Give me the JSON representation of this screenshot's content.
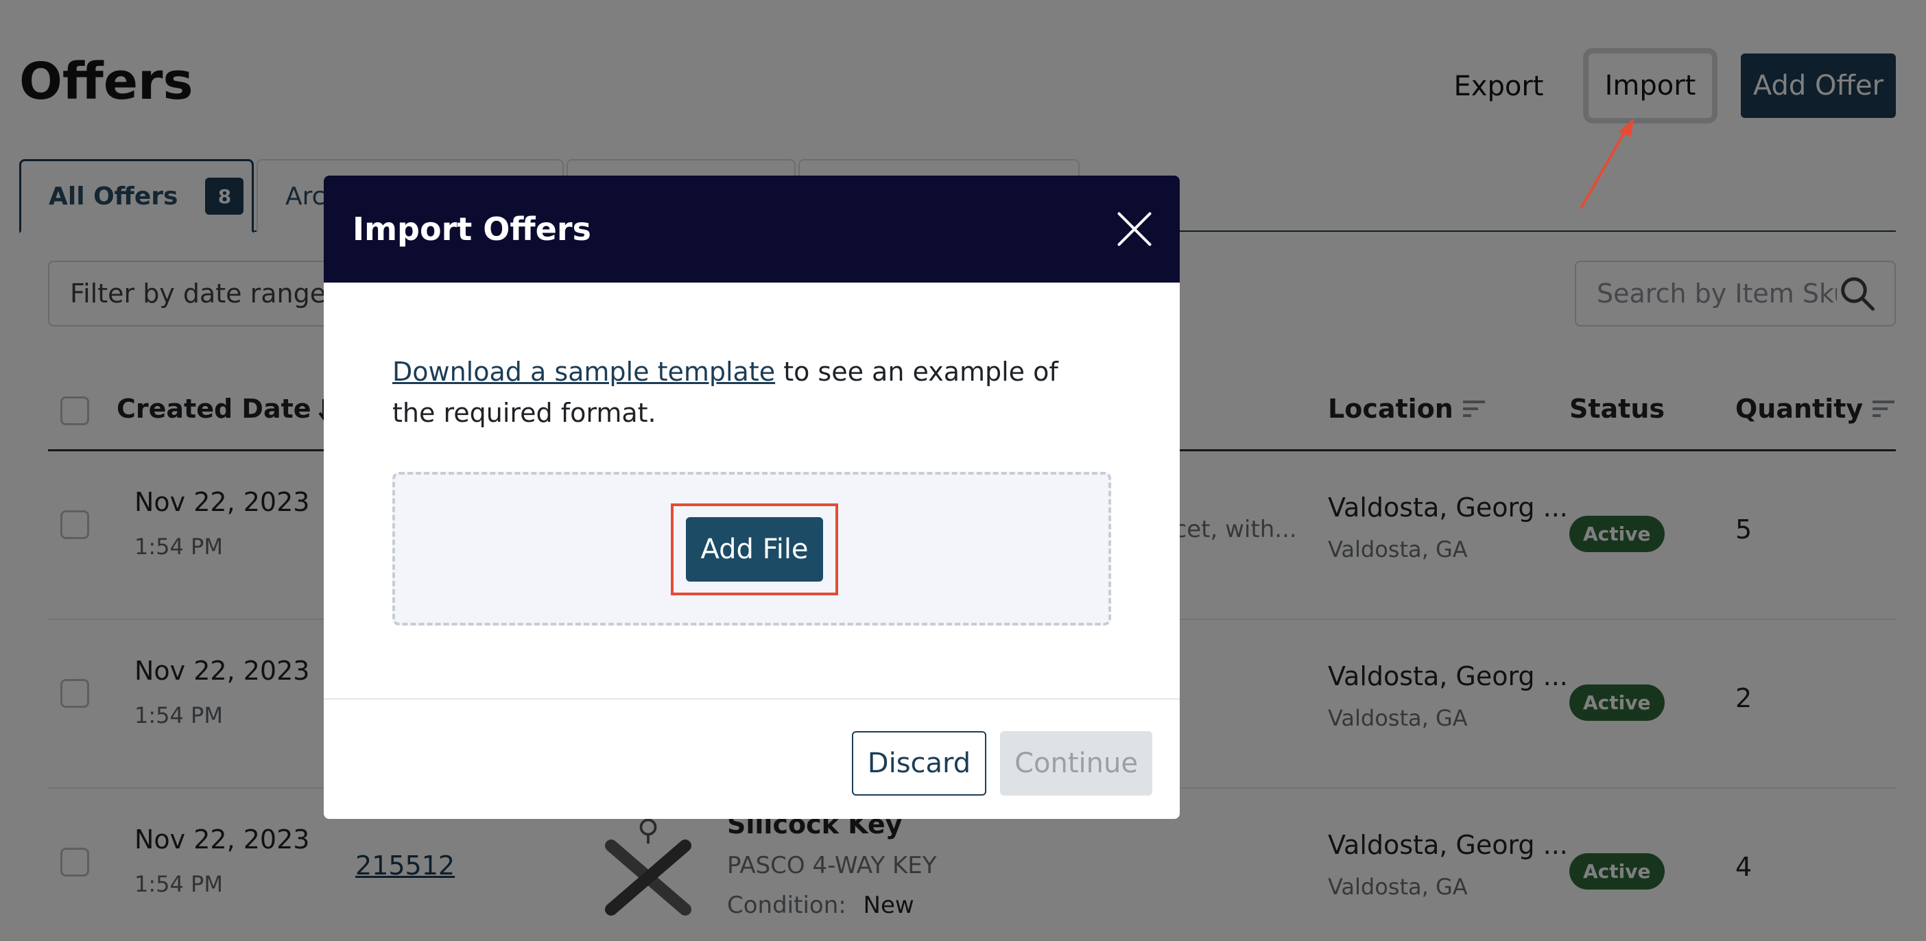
{
  "header": {
    "title": "Offers",
    "export_label": "Export",
    "import_label": "Import",
    "add_offer_label": "Add Offer"
  },
  "tabs": [
    {
      "label": "All Offers",
      "badge": "8",
      "active": true
    },
    {
      "label": "Arc",
      "active": false
    },
    {
      "label": "",
      "active": false
    },
    {
      "label": "",
      "active": false
    }
  ],
  "filters": {
    "date_range_placeholder": "Filter by date range",
    "search_placeholder": "Search by Item Sku"
  },
  "table": {
    "columns": {
      "created_date": "Created Date",
      "location": "Location",
      "status": "Status",
      "quantity": "Quantity"
    },
    "rows": [
      {
        "date": "Nov 22, 2023",
        "time": "1:54 PM",
        "description_partial": "ucet, with...",
        "location": "Valdosta, Georg ...",
        "location_sub": "Valdosta, GA",
        "status": "Active",
        "quantity": "5"
      },
      {
        "date": "Nov 22, 2023",
        "time": "1:54 PM",
        "location": "Valdosta, Georg ...",
        "location_sub": "Valdosta, GA",
        "status": "Active",
        "quantity": "2"
      },
      {
        "date": "Nov 22, 2023",
        "time": "1:54 PM",
        "sku": "215512",
        "title": "Sillcock Key",
        "subtitle": "PASCO 4-WAY KEY",
        "condition_label": "Condition:",
        "condition": "New",
        "location": "Valdosta, Georg ...",
        "location_sub": "Valdosta, GA",
        "status": "Active",
        "quantity": "4"
      }
    ]
  },
  "modal": {
    "title": "Import Offers",
    "link_text": "Download a sample template",
    "body_text": " to see an example of the required format.",
    "add_file_label": "Add File",
    "discard_label": "Discard",
    "continue_label": "Continue"
  },
  "colors": {
    "primary": "#1c3d56",
    "modal_header": "#0b0a2f",
    "status_active": "#2f6b3a",
    "annotation_red": "#e34d36"
  },
  "icons": [
    "close-icon",
    "search-icon",
    "sort-icon",
    "sort-active-icon",
    "arrow-annotation-icon"
  ]
}
